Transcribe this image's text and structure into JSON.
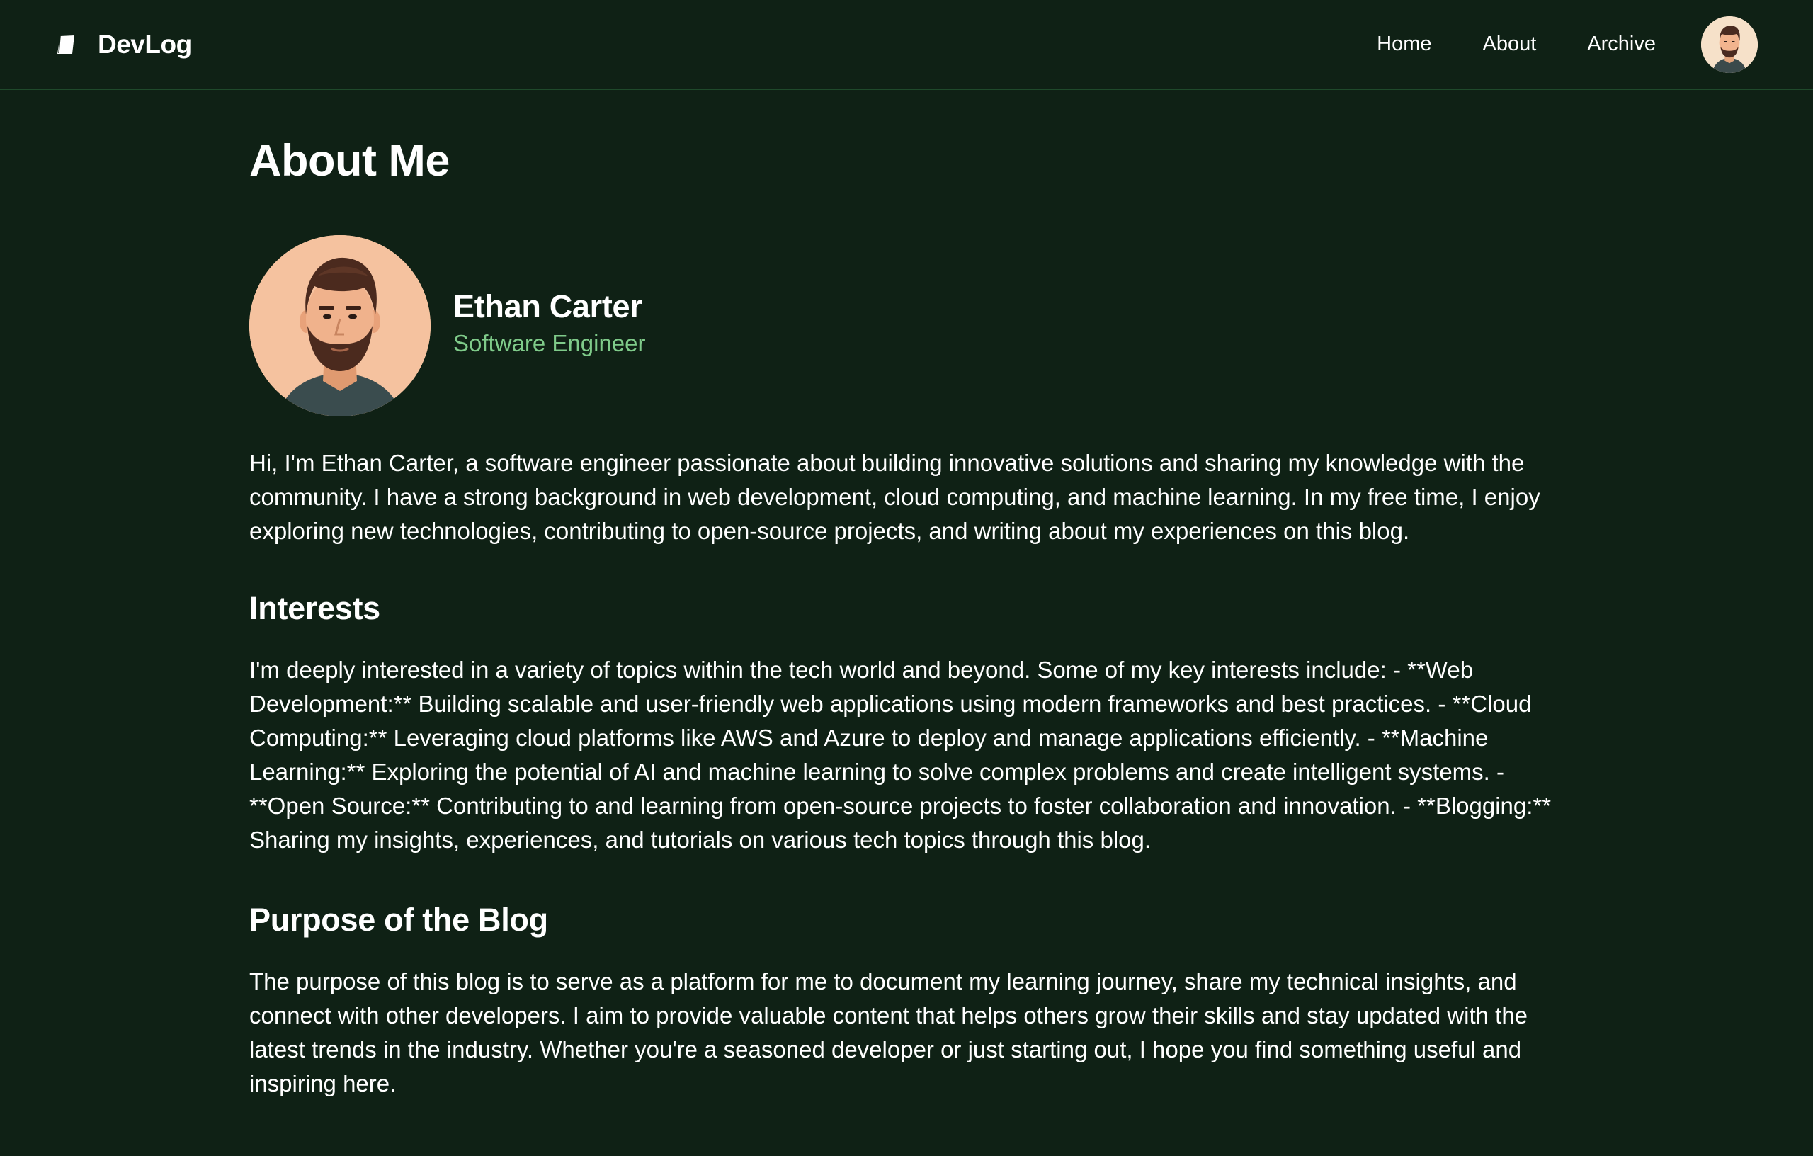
{
  "app": {
    "brand_name": "DevLog",
    "brand_icon": "book-icon"
  },
  "nav": {
    "items": [
      {
        "label": "Home"
      },
      {
        "label": "About"
      },
      {
        "label": "Archive"
      }
    ],
    "avatar_icon": "user-avatar"
  },
  "page": {
    "title": "About Me"
  },
  "profile": {
    "name": "Ethan Carter",
    "role": "Software Engineer"
  },
  "intro": {
    "text": "Hi, I'm Ethan Carter, a software engineer passionate about building innovative solutions and sharing my knowledge with the community. I have a strong background in web development, cloud computing, and machine learning. In my free time, I enjoy exploring new technologies, contributing to open-source projects, and writing about my experiences on this blog."
  },
  "interests": {
    "heading": "Interests",
    "text": "I'm deeply interested in a variety of topics within the tech world and beyond. Some of my key interests include: - **Web Development:** Building scalable and user-friendly web applications using modern frameworks and best practices. - **Cloud Computing:** Leveraging cloud platforms like AWS and Azure to deploy and manage applications efficiently. - **Machine Learning:** Exploring the potential of AI and machine learning to solve complex problems and create intelligent systems. - **Open Source:** Contributing to and learning from open-source projects to foster collaboration and innovation. - **Blogging:** Sharing my insights, experiences, and tutorials on various tech topics through this blog."
  },
  "purpose": {
    "heading": "Purpose of the Blog",
    "text": "The purpose of this blog is to serve as a platform for me to document my learning journey, share my technical insights, and connect with other developers. I aim to provide valuable content that helps others grow their skills and stay updated with the latest trends in the industry. Whether you're a seasoned developer or just starting out, I hope you find something useful and inspiring here."
  },
  "colors": {
    "background": "#0f2115",
    "accent_green": "#7fcb8a",
    "header_border": "#1f4a2b",
    "text": "#ffffff"
  }
}
